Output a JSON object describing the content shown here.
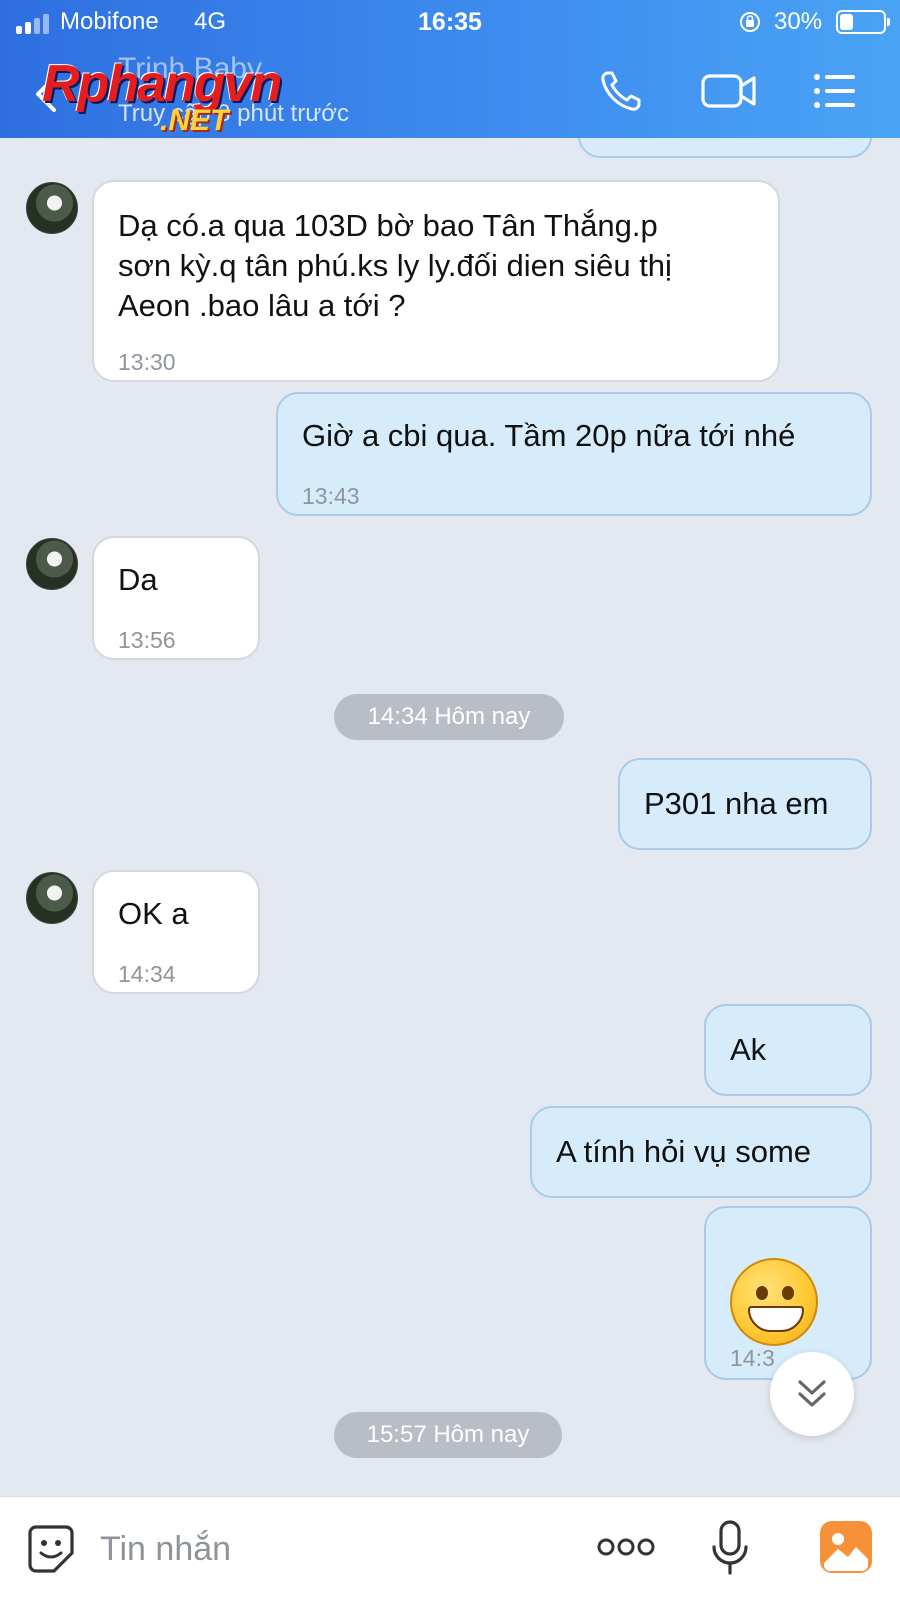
{
  "status_bar": {
    "carrier": "Mobifone",
    "network": "4G",
    "time": "16:35",
    "battery": "30%",
    "battery_level": 0.3
  },
  "header": {
    "contact_name": "Trinh Baby",
    "contact_status": "Truy cập 3 phút trước",
    "watermark_main": "Rphangvn",
    "watermark_sub": ".NET",
    "icons": [
      "back-icon",
      "phone-icon",
      "video-call-icon",
      "menu-list-icon"
    ],
    "accent_color": "#3f8ef0"
  },
  "messages": [
    {
      "direction": "in",
      "text": "Dạ có.a qua 103D bờ bao Tân Thắng.p",
      "text2": "sơn kỳ.q tân phú.ks ly ly.đối dien siêu thị",
      "text3": "Aeon .bao lâu a tới ?",
      "time": "13:30"
    },
    {
      "direction": "out",
      "text": "Giờ a cbi qua. Tầm 20p nữa tới nhé",
      "time": "13:43"
    },
    {
      "direction": "in",
      "text": "Da",
      "time": "13:56"
    },
    {
      "direction": "out",
      "text": "P301 nha em"
    },
    {
      "direction": "in",
      "text": "OK a",
      "time": "14:34"
    },
    {
      "direction": "out",
      "text": "Ak"
    },
    {
      "direction": "out",
      "text": "A tính hỏi vụ some"
    },
    {
      "direction": "out",
      "emoji": "grinning-face-emoji",
      "time": "14:3"
    }
  ],
  "date_separators": [
    {
      "label": "14:34 Hôm nay"
    },
    {
      "label": "15:57 Hôm nay"
    }
  ],
  "input_bar": {
    "placeholder": "Tin nhắn",
    "icons": [
      "sticker-icon",
      "more-icon",
      "microphone-icon",
      "image-icon"
    ]
  },
  "colors": {
    "incoming_bubble": "#ffffff",
    "outgoing_bubble": "#d6ecfb",
    "chat_background": "#e4e8f0"
  }
}
